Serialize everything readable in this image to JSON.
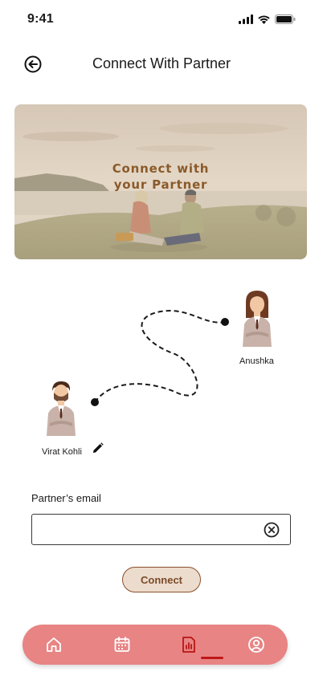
{
  "status_bar": {
    "time": "9:41"
  },
  "header": {
    "title": "Connect With Partner"
  },
  "banner": {
    "line1": "Connect with",
    "line2": "your Partner"
  },
  "partners": {
    "partner": {
      "name": "Anushka"
    },
    "user": {
      "name": "Virat Kohli"
    }
  },
  "form": {
    "email_label": "Partner’s email",
    "email_value": "",
    "connect_label": "Connect"
  },
  "nav": {
    "items": [
      "home-icon",
      "calendar-icon",
      "report-icon",
      "profile-icon"
    ],
    "active": "report-icon"
  },
  "colors": {
    "accent": "#e88484",
    "active_indicator": "#c01818",
    "button_fill": "#ecdccd",
    "button_text": "#7a4a2a",
    "banner_title": "#8a5a2a"
  }
}
